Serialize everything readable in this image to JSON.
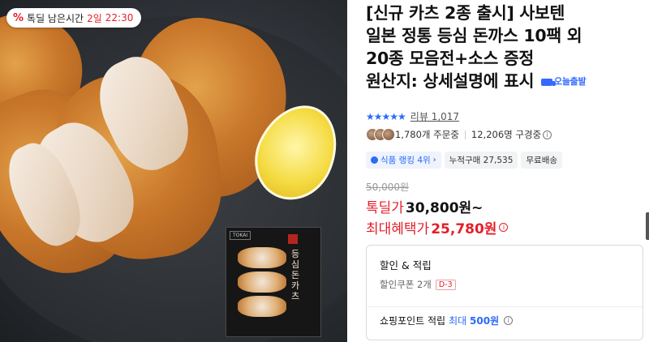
{
  "badge": {
    "icon": "percent-icon",
    "label": "톡딜 남은시간",
    "days": "2일",
    "time": "22:30"
  },
  "package": {
    "brand": "TOKAI",
    "title": "등심돈카츠"
  },
  "product": {
    "title_lines": [
      "[신규 카츠 2종 출시] 사보텐",
      "일본 정통 등심 돈까스 10팩 외",
      "20종 모음전+소스 증정",
      "원산지: 상세설명에 표시"
    ],
    "delivery_tag": "오늘출발"
  },
  "rating": {
    "stars": "★★★★★",
    "review_text": "리뷰 1,017"
  },
  "social": {
    "orders": "1,780개 주문중",
    "viewers": "12,206명 구경중"
  },
  "chips": {
    "ranking": "식품 랭킹 4위",
    "cumulative": "누적구매 27,535",
    "shipping": "무료배송"
  },
  "price": {
    "original": "50,000원",
    "deal_label": "톡딜가",
    "deal_price": "30,800원~",
    "max_label": "최대혜택가",
    "max_price": "25,780원"
  },
  "benefits": {
    "title": "할인 & 적립",
    "coupon": "할인쿠폰 2개",
    "coupon_dday": "D-3",
    "points_label": "쇼핑포인트 적립",
    "points_max": "최대",
    "points_value": "500원"
  },
  "colors": {
    "accent_red": "#e51f29",
    "accent_blue": "#2c6bf6"
  }
}
